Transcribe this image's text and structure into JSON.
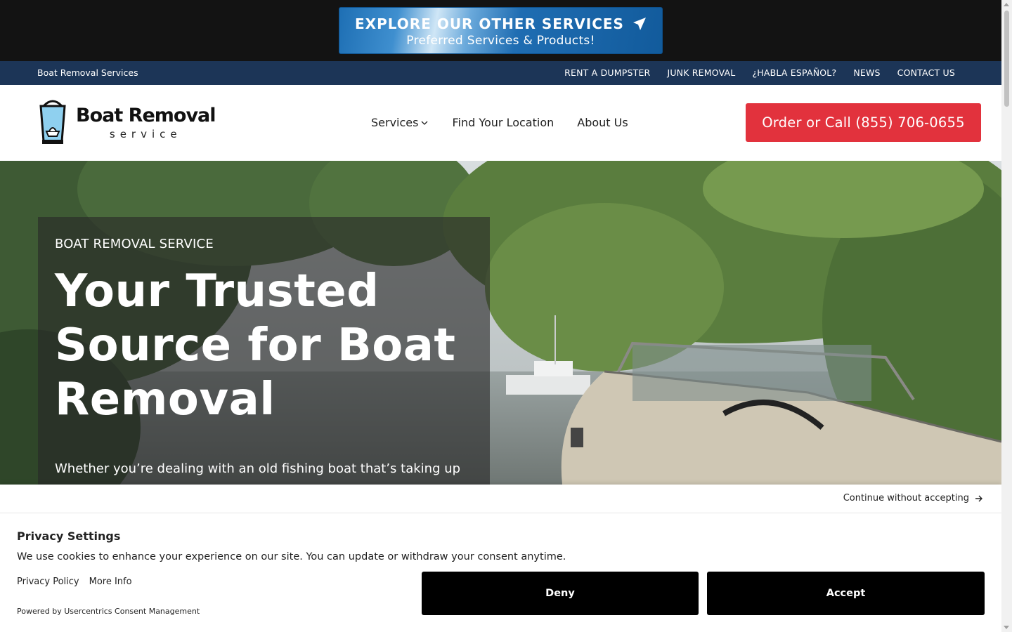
{
  "promo": {
    "line1": "EXPLORE OUR OTHER SERVICES",
    "line2": "Preferred Services & Products!",
    "icon": "paper-plane-icon"
  },
  "utility_nav": {
    "brand": "Boat Removal Services",
    "links": [
      "RENT A DUMPSTER",
      "JUNK REMOVAL",
      "¿HABLA ESPAÑOL?",
      "NEWS",
      "CONTACT US"
    ]
  },
  "header": {
    "logo_title": "Boat Removal",
    "logo_sub": "service",
    "nav": {
      "services": "Services",
      "find_location": "Find Your Location",
      "about": "About Us"
    },
    "cta": "Order or Call (855) 706-0655"
  },
  "hero": {
    "eyebrow": "BOAT REMOVAL SERVICE",
    "title": "Your Trusted Source for Boat Removal",
    "description": "Whether you’re dealing with an old fishing boat that’s taking up"
  },
  "consent": {
    "continue": "Continue without accepting",
    "title": "Privacy Settings",
    "text": "We use cookies to enhance your experience on our site. You can update or withdraw your consent anytime.",
    "privacy_policy": "Privacy Policy",
    "more_info": "More Info",
    "powered_by": "Powered by Usercentrics Consent Management",
    "deny": "Deny",
    "accept": "Accept"
  },
  "colors": {
    "promo_bg": "#131313",
    "utility_bg": "#1c3557",
    "cta_red": "#e2323d",
    "button_black": "#000000"
  }
}
